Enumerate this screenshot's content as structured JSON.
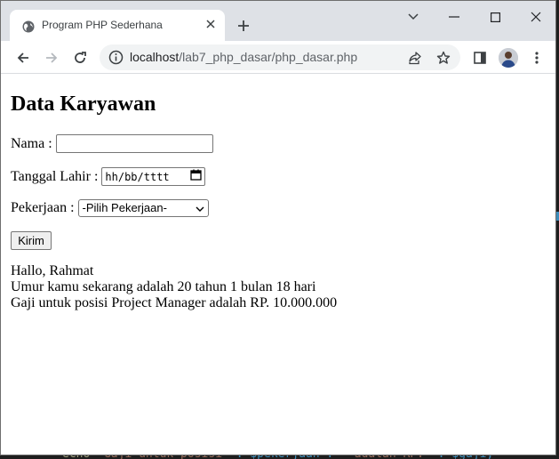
{
  "browser": {
    "tab_title": "Program PHP Sederhana",
    "url_host": "localhost",
    "url_path": "/lab7_php_dasar/php_dasar.php"
  },
  "page": {
    "title": "Data Karyawan",
    "form": {
      "nama_label": "Nama :",
      "nama_value": "",
      "tanggal_label": "Tanggal Lahir :",
      "tanggal_placeholder": "hh/bb/tttt",
      "pekerjaan_label": "Pekerjaan :",
      "pekerjaan_selected": "-Pilih Pekerjaan-",
      "submit_label": "Kirim"
    },
    "result": {
      "greeting": "Hallo, Rahmat",
      "age": "Umur kamu sekarang adalah 20 tahun 1 bulan 18 hari",
      "salary": "Gaji untuk posisi Project Manager adalah RP. 10.000.000"
    }
  },
  "background_editor": {
    "code_line_1": "echo ",
    "code_line_2": "\"Gaji untuk posisi \"",
    "code_line_3": ". $pekerjaan . ",
    "code_line_4": "\" adalah RP. \"",
    "code_line_5": ". $gaji;"
  }
}
